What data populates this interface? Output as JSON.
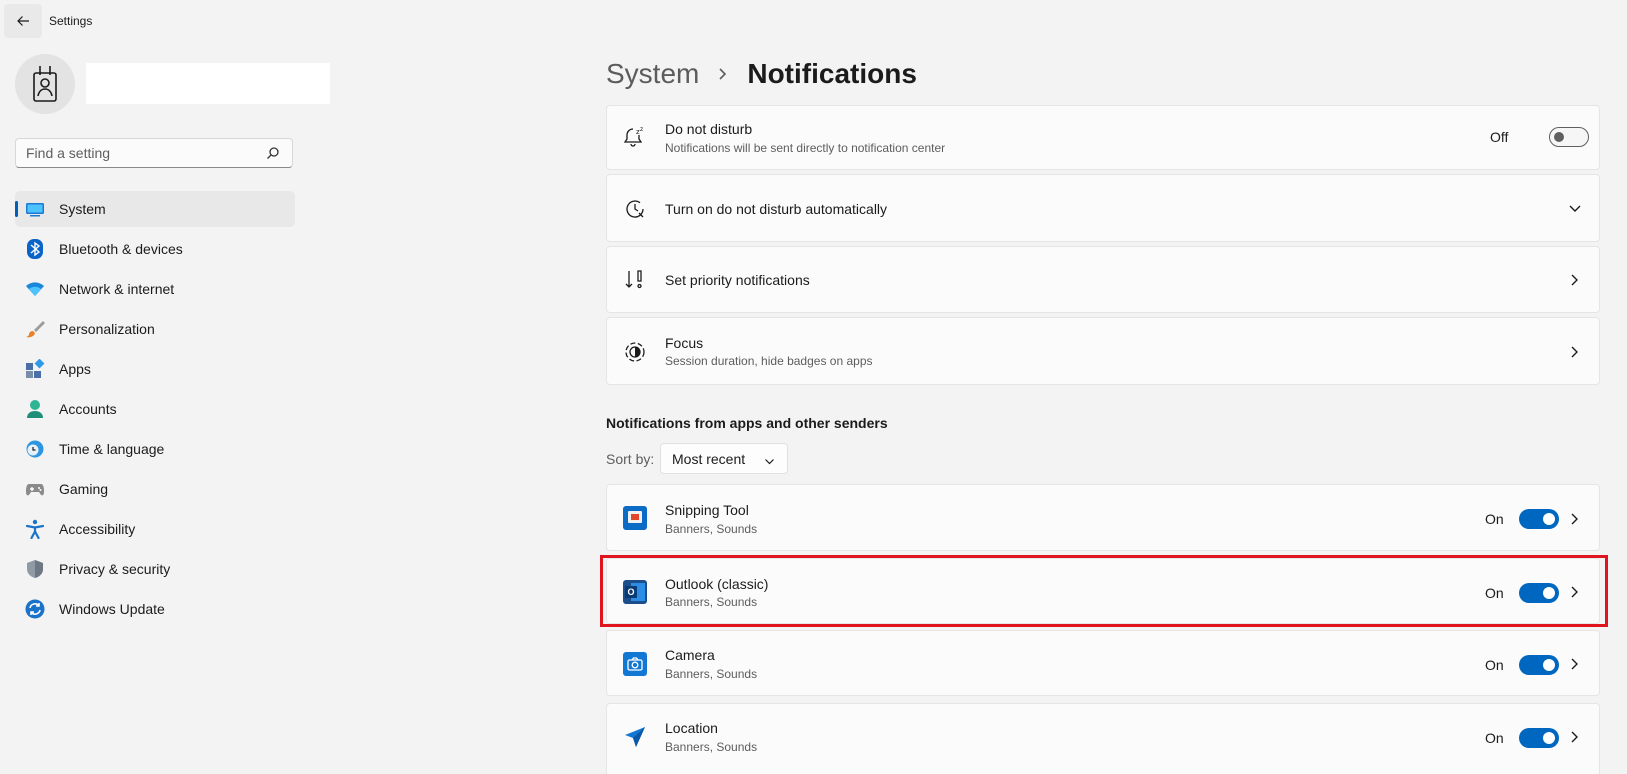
{
  "window": {
    "title": "Settings"
  },
  "search": {
    "placeholder": "Find a setting"
  },
  "sidebar": {
    "items": [
      {
        "label": "System",
        "icon": "system-icon",
        "active": true
      },
      {
        "label": "Bluetooth & devices",
        "icon": "bluetooth-icon"
      },
      {
        "label": "Network & internet",
        "icon": "wifi-icon"
      },
      {
        "label": "Personalization",
        "icon": "brush-icon"
      },
      {
        "label": "Apps",
        "icon": "apps-icon"
      },
      {
        "label": "Accounts",
        "icon": "accounts-icon"
      },
      {
        "label": "Time & language",
        "icon": "time-language-icon"
      },
      {
        "label": "Gaming",
        "icon": "gamepad-icon"
      },
      {
        "label": "Accessibility",
        "icon": "accessibility-icon"
      },
      {
        "label": "Privacy & security",
        "icon": "shield-icon"
      },
      {
        "label": "Windows Update",
        "icon": "update-icon"
      }
    ]
  },
  "breadcrumb": {
    "parent": "System",
    "current": "Notifications"
  },
  "settings": {
    "dnd": {
      "title": "Do not disturb",
      "subtitle": "Notifications will be sent directly to notification center",
      "state": "Off"
    },
    "dnd_auto": {
      "title": "Turn on do not disturb automatically"
    },
    "priority": {
      "title": "Set priority notifications"
    },
    "focus": {
      "title": "Focus",
      "subtitle": "Session duration, hide badges on apps"
    }
  },
  "apps_section": {
    "title": "Notifications from apps and other senders",
    "sort_label": "Sort by:",
    "sort_value": "Most recent",
    "apps": [
      {
        "name": "Snipping Tool",
        "detail": "Banners, Sounds",
        "state": "On",
        "icon": "snipping-tool-icon"
      },
      {
        "name": "Outlook (classic)",
        "detail": "Banners, Sounds",
        "state": "On",
        "icon": "outlook-icon",
        "highlighted": true
      },
      {
        "name": "Camera",
        "detail": "Banners, Sounds",
        "state": "On",
        "icon": "camera-icon"
      },
      {
        "name": "Location",
        "detail": "Banners, Sounds",
        "state": "On",
        "icon": "location-icon"
      }
    ]
  },
  "colors": {
    "accent": "#0067c0",
    "highlight": "#e0141e",
    "background": "#f3f3f3"
  }
}
